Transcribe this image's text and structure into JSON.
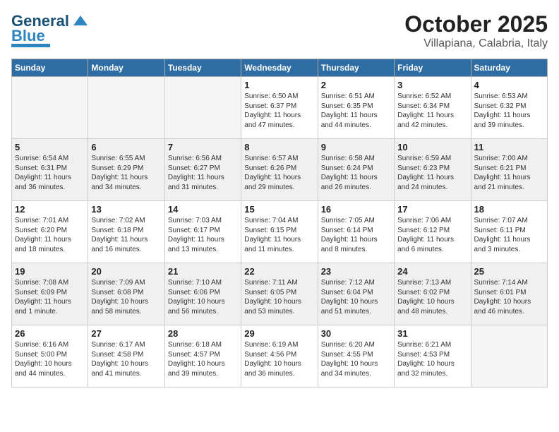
{
  "header": {
    "logo_general": "General",
    "logo_blue": "Blue",
    "title": "October 2025",
    "subtitle": "Villapiana, Calabria, Italy"
  },
  "weekdays": [
    "Sunday",
    "Monday",
    "Tuesday",
    "Wednesday",
    "Thursday",
    "Friday",
    "Saturday"
  ],
  "weeks": [
    [
      {
        "day": "",
        "empty": true
      },
      {
        "day": "",
        "empty": true
      },
      {
        "day": "",
        "empty": true
      },
      {
        "day": "1",
        "info": "Sunrise: 6:50 AM\nSunset: 6:37 PM\nDaylight: 11 hours\nand 47 minutes."
      },
      {
        "day": "2",
        "info": "Sunrise: 6:51 AM\nSunset: 6:35 PM\nDaylight: 11 hours\nand 44 minutes."
      },
      {
        "day": "3",
        "info": "Sunrise: 6:52 AM\nSunset: 6:34 PM\nDaylight: 11 hours\nand 42 minutes."
      },
      {
        "day": "4",
        "info": "Sunrise: 6:53 AM\nSunset: 6:32 PM\nDaylight: 11 hours\nand 39 minutes."
      }
    ],
    [
      {
        "day": "5",
        "info": "Sunrise: 6:54 AM\nSunset: 6:31 PM\nDaylight: 11 hours\nand 36 minutes.",
        "shaded": true
      },
      {
        "day": "6",
        "info": "Sunrise: 6:55 AM\nSunset: 6:29 PM\nDaylight: 11 hours\nand 34 minutes.",
        "shaded": true
      },
      {
        "day": "7",
        "info": "Sunrise: 6:56 AM\nSunset: 6:27 PM\nDaylight: 11 hours\nand 31 minutes.",
        "shaded": true
      },
      {
        "day": "8",
        "info": "Sunrise: 6:57 AM\nSunset: 6:26 PM\nDaylight: 11 hours\nand 29 minutes.",
        "shaded": true
      },
      {
        "day": "9",
        "info": "Sunrise: 6:58 AM\nSunset: 6:24 PM\nDaylight: 11 hours\nand 26 minutes.",
        "shaded": true
      },
      {
        "day": "10",
        "info": "Sunrise: 6:59 AM\nSunset: 6:23 PM\nDaylight: 11 hours\nand 24 minutes.",
        "shaded": true
      },
      {
        "day": "11",
        "info": "Sunrise: 7:00 AM\nSunset: 6:21 PM\nDaylight: 11 hours\nand 21 minutes.",
        "shaded": true
      }
    ],
    [
      {
        "day": "12",
        "info": "Sunrise: 7:01 AM\nSunset: 6:20 PM\nDaylight: 11 hours\nand 18 minutes."
      },
      {
        "day": "13",
        "info": "Sunrise: 7:02 AM\nSunset: 6:18 PM\nDaylight: 11 hours\nand 16 minutes."
      },
      {
        "day": "14",
        "info": "Sunrise: 7:03 AM\nSunset: 6:17 PM\nDaylight: 11 hours\nand 13 minutes."
      },
      {
        "day": "15",
        "info": "Sunrise: 7:04 AM\nSunset: 6:15 PM\nDaylight: 11 hours\nand 11 minutes."
      },
      {
        "day": "16",
        "info": "Sunrise: 7:05 AM\nSunset: 6:14 PM\nDaylight: 11 hours\nand 8 minutes."
      },
      {
        "day": "17",
        "info": "Sunrise: 7:06 AM\nSunset: 6:12 PM\nDaylight: 11 hours\nand 6 minutes."
      },
      {
        "day": "18",
        "info": "Sunrise: 7:07 AM\nSunset: 6:11 PM\nDaylight: 11 hours\nand 3 minutes."
      }
    ],
    [
      {
        "day": "19",
        "info": "Sunrise: 7:08 AM\nSunset: 6:09 PM\nDaylight: 11 hours\nand 1 minute.",
        "shaded": true
      },
      {
        "day": "20",
        "info": "Sunrise: 7:09 AM\nSunset: 6:08 PM\nDaylight: 10 hours\nand 58 minutes.",
        "shaded": true
      },
      {
        "day": "21",
        "info": "Sunrise: 7:10 AM\nSunset: 6:06 PM\nDaylight: 10 hours\nand 56 minutes.",
        "shaded": true
      },
      {
        "day": "22",
        "info": "Sunrise: 7:11 AM\nSunset: 6:05 PM\nDaylight: 10 hours\nand 53 minutes.",
        "shaded": true
      },
      {
        "day": "23",
        "info": "Sunrise: 7:12 AM\nSunset: 6:04 PM\nDaylight: 10 hours\nand 51 minutes.",
        "shaded": true
      },
      {
        "day": "24",
        "info": "Sunrise: 7:13 AM\nSunset: 6:02 PM\nDaylight: 10 hours\nand 48 minutes.",
        "shaded": true
      },
      {
        "day": "25",
        "info": "Sunrise: 7:14 AM\nSunset: 6:01 PM\nDaylight: 10 hours\nand 46 minutes.",
        "shaded": true
      }
    ],
    [
      {
        "day": "26",
        "info": "Sunrise: 6:16 AM\nSunset: 5:00 PM\nDaylight: 10 hours\nand 44 minutes."
      },
      {
        "day": "27",
        "info": "Sunrise: 6:17 AM\nSunset: 4:58 PM\nDaylight: 10 hours\nand 41 minutes."
      },
      {
        "day": "28",
        "info": "Sunrise: 6:18 AM\nSunset: 4:57 PM\nDaylight: 10 hours\nand 39 minutes."
      },
      {
        "day": "29",
        "info": "Sunrise: 6:19 AM\nSunset: 4:56 PM\nDaylight: 10 hours\nand 36 minutes."
      },
      {
        "day": "30",
        "info": "Sunrise: 6:20 AM\nSunset: 4:55 PM\nDaylight: 10 hours\nand 34 minutes."
      },
      {
        "day": "31",
        "info": "Sunrise: 6:21 AM\nSunset: 4:53 PM\nDaylight: 10 hours\nand 32 minutes."
      },
      {
        "day": "",
        "empty": true
      }
    ]
  ]
}
